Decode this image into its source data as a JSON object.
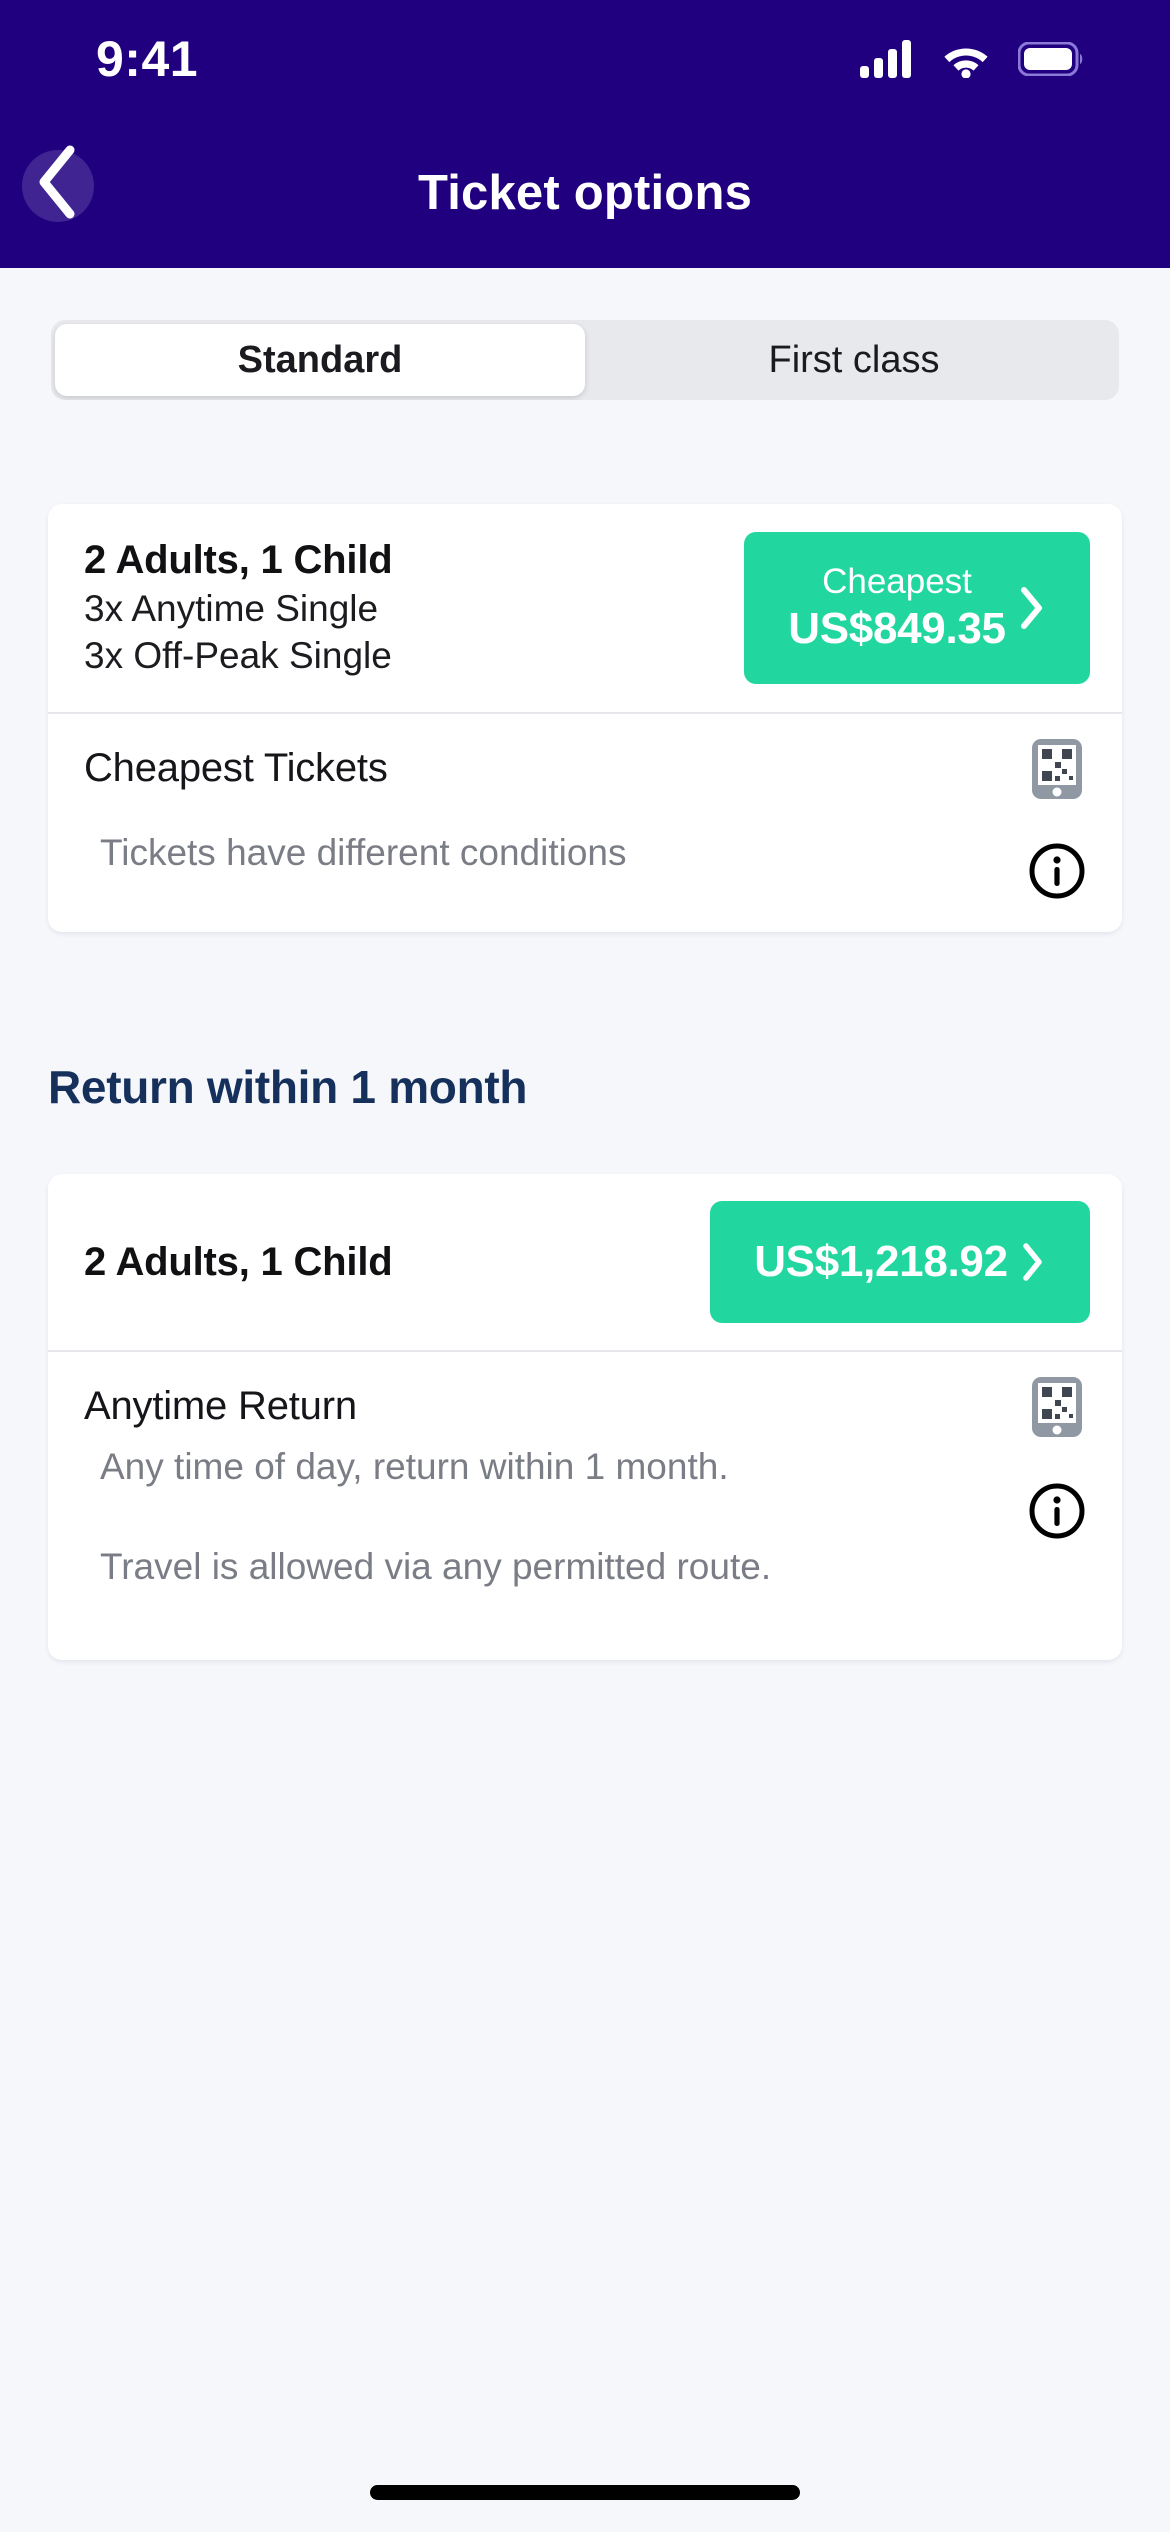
{
  "status_bar": {
    "time": "9:41",
    "signal_icon": "cellular-signal-icon",
    "wifi_icon": "wifi-icon",
    "battery_icon": "battery-full-icon"
  },
  "header": {
    "title": "Ticket options",
    "back_icon": "chevron-left-icon",
    "background_color": "#210080"
  },
  "segmented_control": {
    "options": [
      {
        "label": "Standard",
        "selected": true
      },
      {
        "label": "First class",
        "selected": false
      }
    ]
  },
  "colors": {
    "accent_green": "#22D6A0",
    "page_background": "#F6F7FB",
    "heading_navy": "#16305C",
    "muted_text": "#7A7D85"
  },
  "outbound_card": {
    "passengers": "2 Adults, 1 Child",
    "ticket_lines": [
      "3x Anytime Single",
      "3x Off-Peak Single"
    ],
    "price_label": "Cheapest",
    "price": "US$849.35",
    "chevron_icon": "chevron-right-icon",
    "conditions_title": "Cheapest Tickets",
    "conditions_subtitle": "Tickets have different conditions",
    "mobile_ticket_icon": "mobile-ticket-qr-icon",
    "info_icon": "info-circle-icon"
  },
  "return_section": {
    "heading": "Return within 1 month",
    "card": {
      "passengers": "2 Adults, 1 Child",
      "price": "US$1,218.92",
      "chevron_icon": "chevron-right-icon",
      "ticket_name": "Anytime Return",
      "description_line_1": "Any time of day, return within 1 month.",
      "description_line_2": "Travel is allowed via any permitted route.",
      "mobile_ticket_icon": "mobile-ticket-qr-icon",
      "info_icon": "info-circle-icon"
    }
  }
}
